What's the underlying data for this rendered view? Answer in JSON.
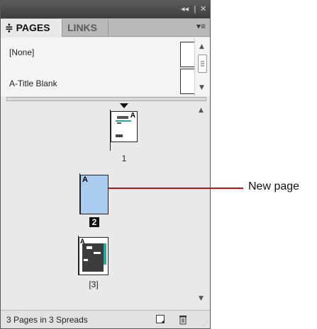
{
  "titlebar": {
    "collapse_label": "◂◂",
    "separator": "|",
    "close_label": "✕"
  },
  "tabs": [
    {
      "label": "PAGES",
      "prefix": "≑"
    },
    {
      "label": "LINKS"
    }
  ],
  "panel_menu_label": "▾≡",
  "masters": [
    {
      "name": "[None]"
    },
    {
      "name": "A-Title Blank"
    }
  ],
  "pages": [
    {
      "number": "1",
      "master_prefix": "A"
    },
    {
      "number": "2",
      "master_prefix": "A"
    },
    {
      "number": "[3]",
      "master_prefix": "A"
    }
  ],
  "status": {
    "text": "3 Pages in 3 Spreads"
  },
  "callout": {
    "label": "New page",
    "color": "#c0141c"
  },
  "colors": {
    "selected_page_fill": "#a9ccef",
    "titlebar": "#4a4a4a",
    "accent_teal": "#27a7a0"
  }
}
